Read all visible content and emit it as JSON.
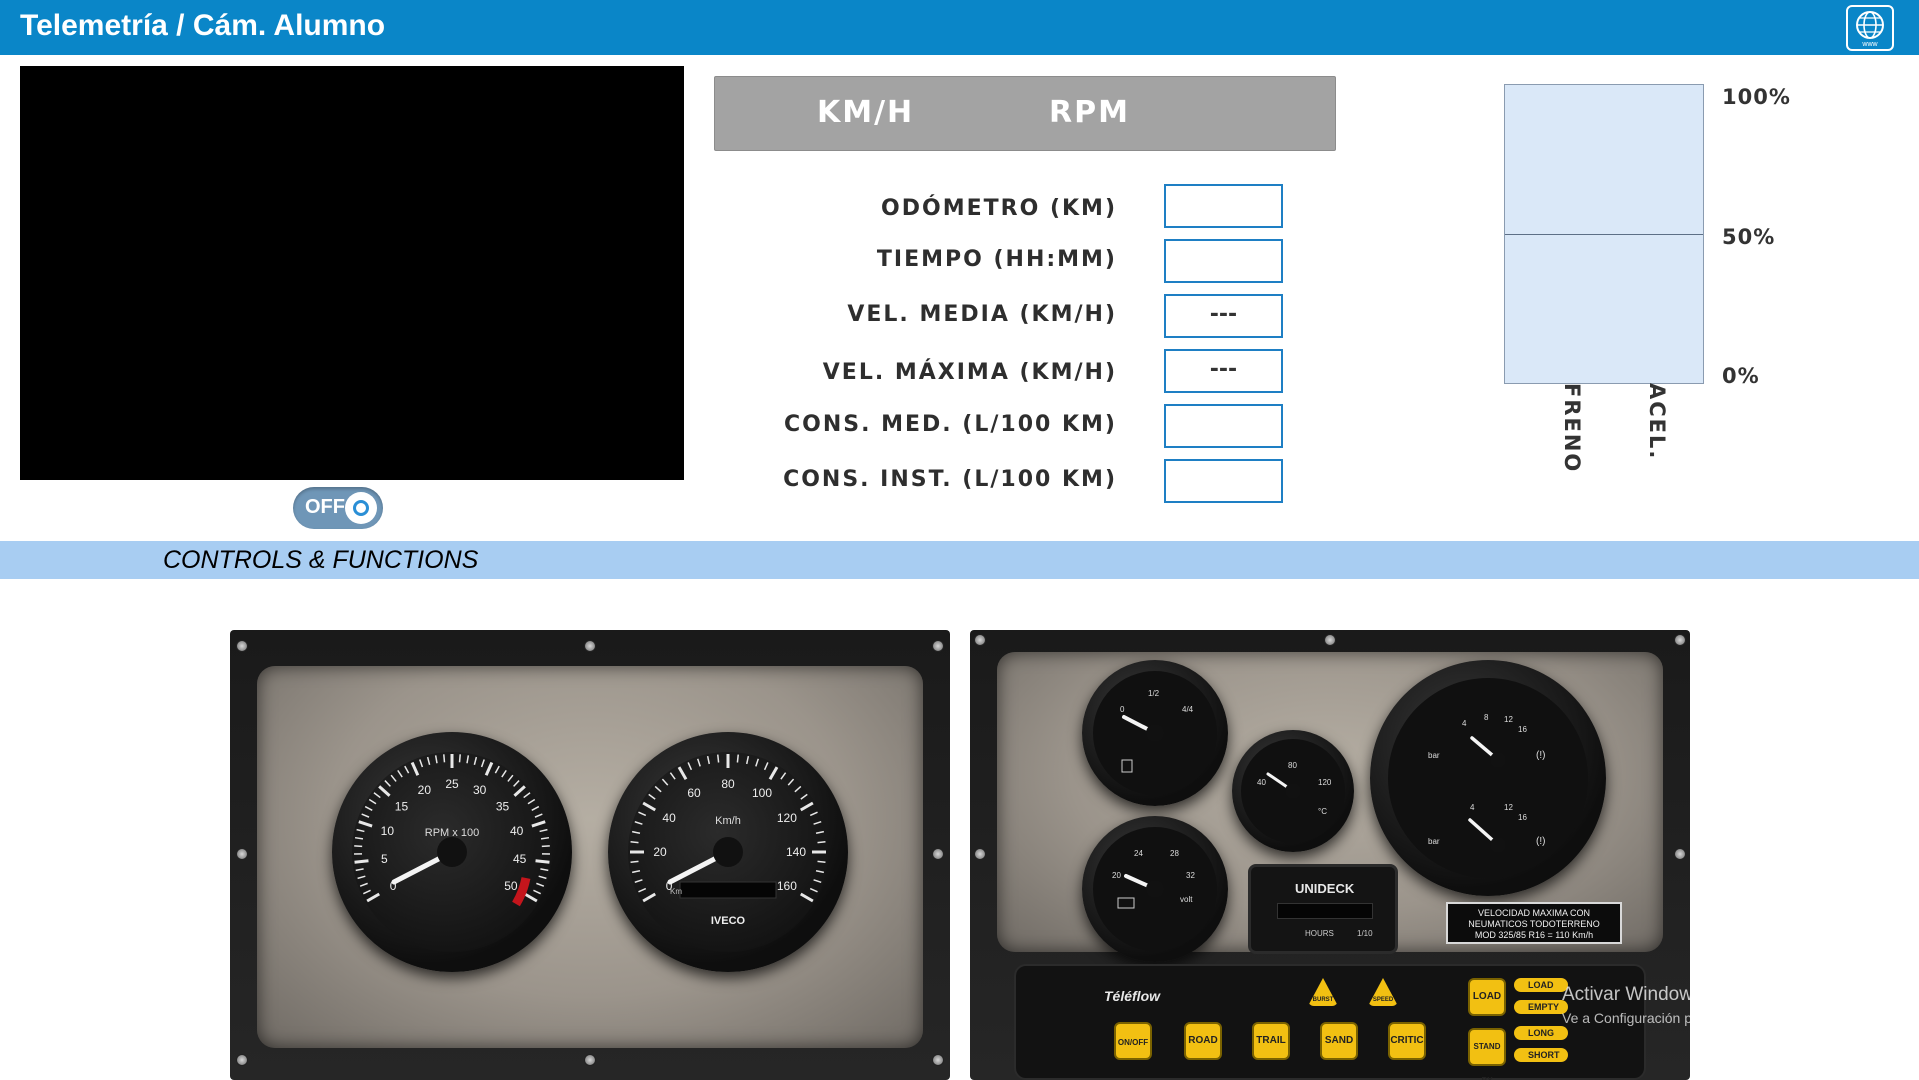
{
  "header": {
    "title": "Telemetría / Cám. Alumno",
    "globe_icon": "globe-www-icon",
    "globe_text": "www"
  },
  "camera": {
    "toggle_label": "OFF"
  },
  "telemetry": {
    "speed_label": "KM/H",
    "rpm_label": "RPM",
    "rows": [
      {
        "label": "ODÓMETRO (KM)",
        "value": ""
      },
      {
        "label": "TIEMPO (HH:MM)",
        "value": ""
      },
      {
        "label": "VEL. MEDIA (KM/H)",
        "value": "---"
      },
      {
        "label": "VEL. MÁXIMA (KM/H)",
        "value": "---"
      },
      {
        "label": "CONS. MED. (L/100 KM)",
        "value": ""
      },
      {
        "label": "CONS. INST. (L/100 KM)",
        "value": ""
      }
    ]
  },
  "pedals": {
    "pct_100": "100%",
    "pct_50": "50%",
    "pct_0": "0%",
    "brake_label": "FRENO",
    "accel_label": "ACEL."
  },
  "section": {
    "title": "CONTROLS & FUNCTIONS"
  },
  "dash_left": {
    "tacho": {
      "unit_label": "RPM x 100",
      "ticks": [
        "0",
        "5",
        "10",
        "15",
        "20",
        "25",
        "30",
        "35",
        "40",
        "45",
        "50"
      ]
    },
    "speedo": {
      "unit_label": "Km/h",
      "brand": "IVECO",
      "odo_label": "Km",
      "ticks": [
        "0",
        "20",
        "40",
        "60",
        "80",
        "100",
        "120",
        "140",
        "160"
      ]
    }
  },
  "dash_right": {
    "fuel": {
      "ticks": [
        "0",
        "1/2",
        "4/4"
      ]
    },
    "temp": {
      "ticks": [
        "40",
        "80",
        "120"
      ],
      "unit": "°C"
    },
    "volt": {
      "ticks": [
        "20",
        "24",
        "28",
        "32"
      ],
      "unit": "volt"
    },
    "pressure": {
      "ticks": [
        "4",
        "8",
        "12",
        "16"
      ],
      "unit": "bar",
      "warn": "(!)"
    },
    "hour_meter": {
      "brand": "UNIDECK",
      "hours_label": "HOURS",
      "scale_label": "1/10"
    },
    "plate_text": [
      "VELOCIDAD MAXIMA CON",
      "NEUMATICOS TODOTERRENO",
      "MOD 325/85 R16 = 110 Km/h"
    ],
    "teleflow": "Téléflow",
    "buttons": [
      "ON/OFF",
      "ROAD",
      "TRAIL",
      "SAND",
      "CRITIC",
      "LOAD",
      "STAND BY"
    ],
    "triangles": [
      "BURST",
      "SPEED"
    ],
    "pills": [
      "LOAD",
      "EMPTY",
      "LONG",
      "SHORT"
    ]
  },
  "watermark": {
    "line1": "Activar Windows",
    "line2": "Ve a Configuración para activar Windows."
  }
}
